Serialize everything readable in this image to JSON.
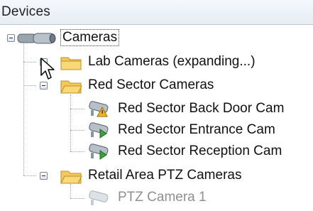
{
  "panel": {
    "title": "Devices"
  },
  "tree": {
    "root": {
      "label": "Cameras",
      "icon": "camera-group-icon",
      "toggle": "collapse"
    },
    "groups": [
      {
        "label": "Lab Cameras (expanding...)",
        "icon": "folder-icon",
        "toggle": "expand"
      },
      {
        "label": "Red Sector Cameras",
        "icon": "folder-icon",
        "toggle": "collapse",
        "items": [
          {
            "label": "Red Sector Back Door Cam",
            "icon": "camera-warning-icon"
          },
          {
            "label": "Red Sector Entrance Cam",
            "icon": "camera-ok-icon"
          },
          {
            "label": "Red Sector Reception Cam",
            "icon": "camera-ok-icon"
          }
        ]
      },
      {
        "label": "Retail Area PTZ Cameras",
        "icon": "folder-icon",
        "toggle": "collapse",
        "items": [
          {
            "label": "PTZ Camera 1",
            "icon": "camera-disabled-icon"
          }
        ]
      }
    ]
  },
  "cursor": {
    "icon": "mouse-pointer-icon"
  },
  "colors": {
    "folder": "#f3c95a",
    "ok": "#3aa23a",
    "warning": "#e7a21b",
    "selection_outline": "#444444"
  }
}
